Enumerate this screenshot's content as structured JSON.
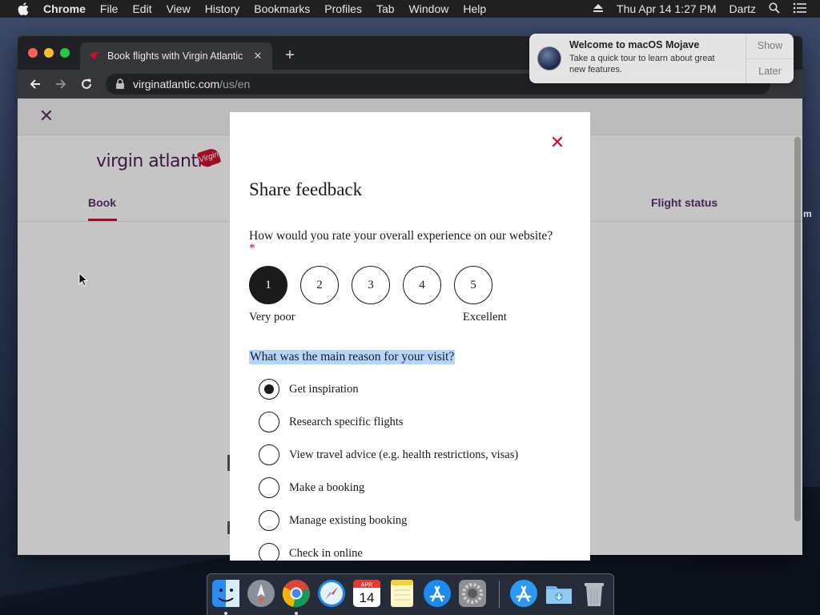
{
  "menubar": {
    "app": "Chrome",
    "items": [
      "File",
      "Edit",
      "View",
      "History",
      "Bookmarks",
      "Profiles",
      "Tab",
      "Window",
      "Help"
    ],
    "clock": "Thu Apr 14  1:27 PM",
    "user": "Dartz"
  },
  "browser": {
    "tab_title": "Book flights with Virgin Atlantic",
    "url_host": "virginatlantic.com",
    "url_path": "/us/en"
  },
  "page": {
    "logo": "virgin atlantic",
    "logo_badge": "Virgin",
    "nav_book": "Book",
    "nav_flight_status": "Flight status",
    "edge_char": "m"
  },
  "notification": {
    "title": "Welcome to macOS Mojave",
    "message": "Take a quick tour to learn about great new features.",
    "show": "Show",
    "later": "Later"
  },
  "modal": {
    "title": "Share feedback",
    "question1": "How would you rate your overall experience on our website?",
    "required_mark": "*",
    "ratings": [
      "1",
      "2",
      "3",
      "4",
      "5"
    ],
    "selected_rating": 1,
    "low_label": "Very poor",
    "high_label": "Excellent",
    "question2": "What was the main reason for your visit?",
    "options": [
      "Get inspiration",
      "Research specific flights",
      "View travel advice (e.g. health restrictions, visas)",
      "Make a booking",
      "Manage existing booking",
      "Check in online"
    ],
    "selected_option": 0
  },
  "dock": {
    "calendar_month": "APR",
    "calendar_day": "14"
  },
  "colors": {
    "brand_purple": "#5c2d6b",
    "brand_red": "#c8102e",
    "selection_blue": "#b4d5fe"
  }
}
